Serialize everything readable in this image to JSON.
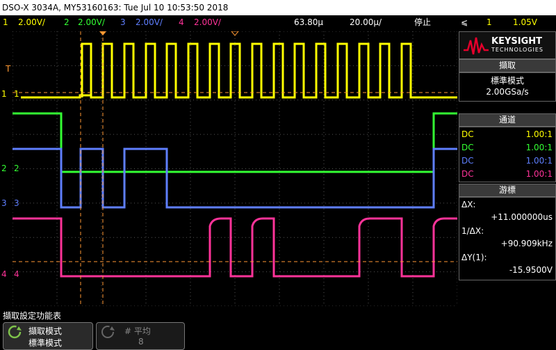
{
  "title_bar": {
    "text": "DSO-X 3034A, MY53160163: Tue Jul 10 10:53:50 2018"
  },
  "status_bar": {
    "channels": [
      {
        "num": "1",
        "scale": "2.00V/",
        "color": "#ffff00"
      },
      {
        "num": "2",
        "scale": "2.00V/",
        "color": "#33ff33"
      },
      {
        "num": "3",
        "scale": "2.00V/",
        "color": "#5f7fff"
      },
      {
        "num": "4",
        "scale": "2.00V/",
        "color": "#ff3399"
      }
    ],
    "time_delay": "63.80µ",
    "time_scale": "20.00µ/",
    "run_state": "停止",
    "trigger_symbol": "⩽",
    "trigger_source": "1",
    "trigger_level": "1.05V"
  },
  "markers": {
    "trigger": "T",
    "ch1": "1",
    "ch2": "2",
    "ch3": "3",
    "ch4": "4"
  },
  "panel": {
    "brand": "KEYSIGHT",
    "brand_sub": "TECHNOLOGIES",
    "acquire": {
      "header": "擷取",
      "mode": "標準模式",
      "rate": "2.00GSa/s"
    },
    "channels": {
      "header": "通道",
      "rows": [
        {
          "coupling": "DC",
          "ratio": "1.00:1",
          "color": "#ffff00"
        },
        {
          "coupling": "DC",
          "ratio": "1.00:1",
          "color": "#33ff33"
        },
        {
          "coupling": "DC",
          "ratio": "1.00:1",
          "color": "#5f7fff"
        },
        {
          "coupling": "DC",
          "ratio": "1.00:1",
          "color": "#ff3399"
        }
      ]
    },
    "cursors": {
      "header": "游標",
      "dx_label": "ΔX:",
      "dx_value": "+11.000000us",
      "inv_dx_label": "1/ΔX:",
      "inv_dx_value": "+90.909kHz",
      "dy_label": "ΔY(1):",
      "dy_value": "-15.9500V"
    }
  },
  "softkeys": {
    "menu_title": "擷取設定功能表",
    "key1_label": "擷取模式",
    "key1_value": "標準模式",
    "key2_label": "# 平均",
    "key2_value": "8"
  },
  "colors": {
    "ch1": "#ffff00",
    "ch2": "#33ff33",
    "ch3": "#5f7fff",
    "ch4": "#ff3399",
    "cursor": "#ff9933",
    "grid": "#555555"
  }
}
